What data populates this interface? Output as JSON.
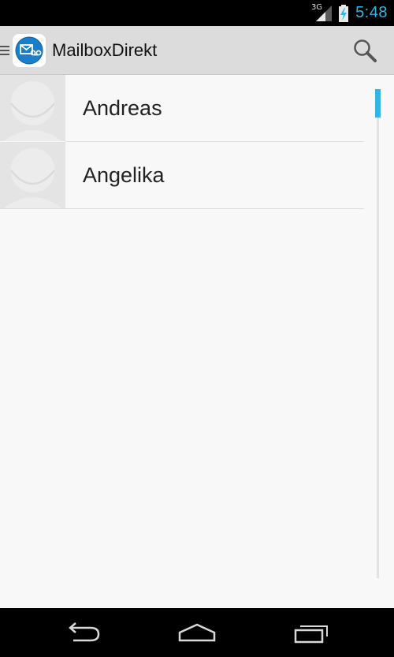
{
  "status_bar": {
    "network_label": "3G",
    "time": "5:48",
    "icons": [
      "signal-icon",
      "battery-charging-icon"
    ],
    "accent_color": "#33b5e5"
  },
  "action_bar": {
    "title": "MailboxDirekt",
    "icons": [
      "menu-indicator-icon",
      "app-logo-mail-icon",
      "search-icon"
    ]
  },
  "contacts": [
    {
      "name": "Andreas"
    },
    {
      "name": "Angelika"
    }
  ],
  "nav_bar": {
    "buttons": [
      "back-icon",
      "home-icon",
      "recents-icon"
    ]
  },
  "scroll_position": 0
}
